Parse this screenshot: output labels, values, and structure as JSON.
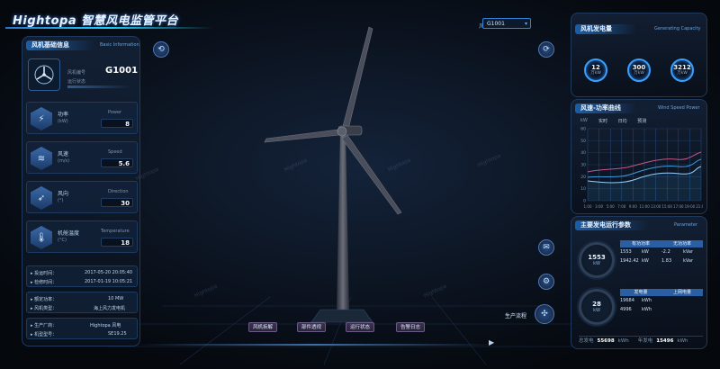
{
  "header": {
    "brand": "Hightopa 智慧风电监管平台",
    "turbine_select_label": "风机编号",
    "turbine_select_value": "G1001"
  },
  "left_panel": {
    "title": "风机基础信息",
    "subtitle": "Basic Information",
    "turbine_id_label": "风机编号",
    "status_label": "运行状态",
    "turbine_id": "G1001",
    "metrics": [
      {
        "label_cn": "功率",
        "unit": "(kW)",
        "label_en": "Power",
        "value": "8"
      },
      {
        "label_cn": "风速",
        "unit": "(m/s)",
        "label_en": "Speed",
        "value": "5.6"
      },
      {
        "label_cn": "风向",
        "unit": "(°)",
        "label_en": "Direction",
        "value": "30"
      },
      {
        "label_cn": "机舱温度",
        "unit": "(°C)",
        "label_en": "Temperature",
        "value": "18"
      }
    ],
    "info_rows_1": [
      {
        "label": "投运时间：",
        "value": "2017-05-20 20:05:40"
      },
      {
        "label": "检修时间：",
        "value": "2017-01-19 10:05:21"
      }
    ],
    "info_rows_2": [
      {
        "label": "额定功率：",
        "value": "10 MW"
      },
      {
        "label": "风机类型：",
        "value": "海上风力发电机"
      }
    ],
    "info_rows_3": [
      {
        "label": "生产厂商：",
        "value": "Hightopa 风电"
      },
      {
        "label": "机型型号：",
        "value": "SE19.25"
      }
    ]
  },
  "viewer": {
    "buttons": [
      "风机拆解",
      "部件透视",
      "运行状态",
      "告警日志"
    ],
    "action_label": "生产流程"
  },
  "right_panel_1": {
    "title": "风机发电量",
    "subtitle": "Generating Capacity",
    "rings": [
      {
        "value": "12",
        "unit": "万kW"
      },
      {
        "value": "300",
        "unit": "万kW"
      },
      {
        "value": "3212",
        "unit": "万kW"
      }
    ]
  },
  "right_panel_2": {
    "title": "风速-功率曲线",
    "subtitle": "Wind Speed Power",
    "legend": [
      "实时",
      "日均",
      "预测"
    ],
    "yunit": "kW",
    "x_ticks": [
      "1:00",
      "3:00",
      "5:00",
      "7:00",
      "9:00",
      "11:00",
      "13:00",
      "15:00",
      "17:00",
      "19:00",
      "21:00"
    ],
    "y_ticks": [
      "60",
      "50",
      "40",
      "30",
      "20",
      "10",
      "0"
    ]
  },
  "right_panel_3": {
    "title": "主要发电运行参数",
    "subtitle": "Parameter",
    "gauge1": {
      "value": "1553",
      "label": "kW"
    },
    "gauge2": {
      "value": "28",
      "label": "kW"
    },
    "table1": {
      "headers": [
        "有功功率",
        "无功功率"
      ],
      "rows": [
        [
          "1553",
          "kW",
          "-2.2",
          "kVar"
        ],
        [
          "1942.42",
          "kW",
          "1.83",
          "kVar"
        ]
      ]
    },
    "table2": {
      "headers": [
        "发电量",
        "上网电量"
      ],
      "rows": [
        [
          "19684",
          "kWh",
          "",
          ""
        ],
        [
          "4996",
          "kWh",
          "",
          ""
        ]
      ]
    },
    "footer": [
      {
        "label": "总发电",
        "value": "55698",
        "unit": "kWh"
      },
      {
        "label": "年发电",
        "value": "15496",
        "unit": "kWh"
      }
    ]
  },
  "colors": {
    "accent": "#2d8cf0",
    "panel": "#0d1828",
    "line1": "#c7548a",
    "line2": "#3e9be0"
  }
}
